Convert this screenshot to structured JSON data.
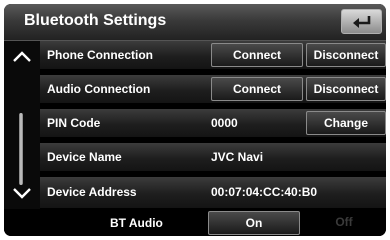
{
  "header": {
    "title": "Bluetooth Settings",
    "back_icon": "return-arrow-icon"
  },
  "scroll": {
    "up_icon": "chevron-up-icon",
    "down_icon": "chevron-down-icon"
  },
  "rows": [
    {
      "label": "Phone Connection",
      "connect": "Connect",
      "disconnect": "Disconnect"
    },
    {
      "label": "Audio Connection",
      "connect": "Connect",
      "disconnect": "Disconnect"
    },
    {
      "label": "PIN Code",
      "value": "0000",
      "action": "Change"
    },
    {
      "label": "Device Name",
      "value": "JVC Navi"
    },
    {
      "label": "Device Address",
      "value": "00:07:04:CC:40:B0"
    }
  ],
  "bt_audio": {
    "label": "BT Audio",
    "on": "On",
    "off": "Off",
    "selected": "On"
  }
}
